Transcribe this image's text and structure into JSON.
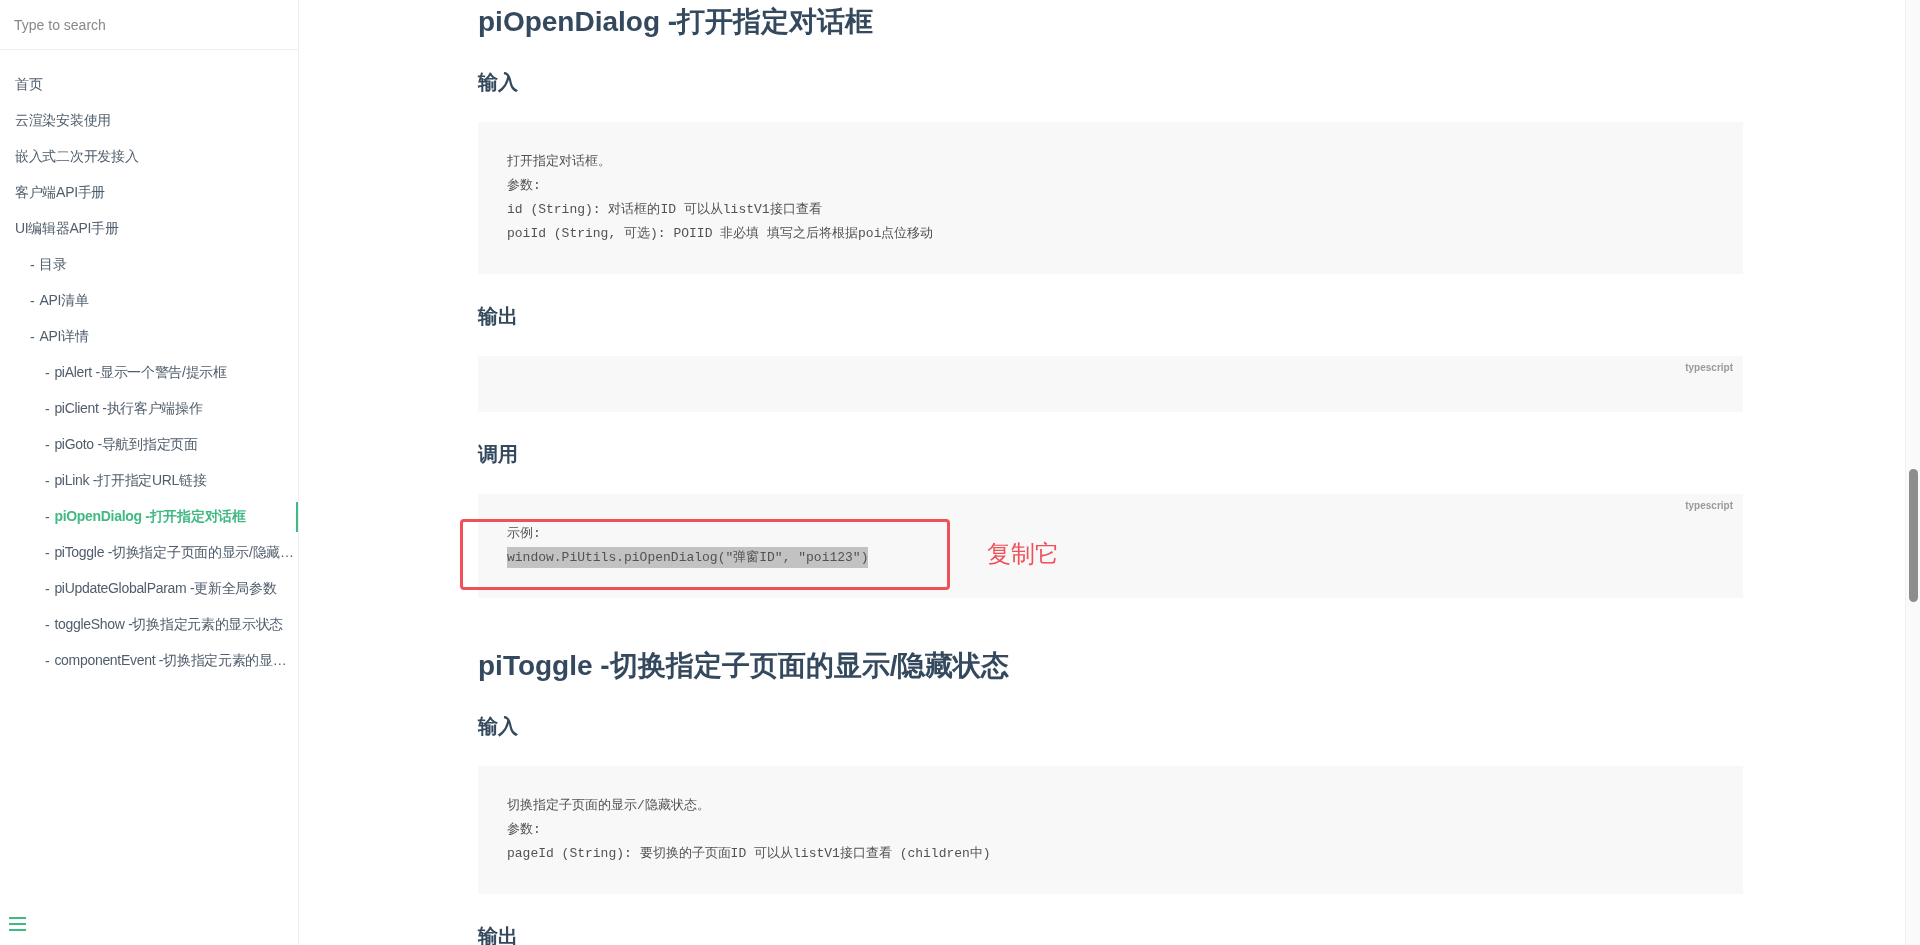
{
  "sidebar": {
    "search": {
      "placeholder": "Type to search"
    },
    "items": [
      {
        "label": "首页",
        "selected": false
      },
      {
        "label": "云渲染安装使用",
        "selected": false
      },
      {
        "label": "嵌入式二次开发接入",
        "selected": false
      },
      {
        "label": "客户端API手册",
        "selected": false
      },
      {
        "label": "UI编辑器API手册",
        "selected": false,
        "children": [
          {
            "marker": "-",
            "label": "目录",
            "selected": false
          },
          {
            "marker": "-",
            "label": "API清单",
            "selected": false
          },
          {
            "marker": "-",
            "label": "API详情",
            "selected": false,
            "children": [
              {
                "marker": "-",
                "label": "piAlert -显示一个警告/提示框",
                "selected": false
              },
              {
                "marker": "-",
                "label": "piClient -执行客户端操作",
                "selected": false
              },
              {
                "marker": "-",
                "label": "piGoto -导航到指定页面",
                "selected": false
              },
              {
                "marker": "-",
                "label": "piLink -打开指定URL链接",
                "selected": false
              },
              {
                "marker": "-",
                "label": "piOpenDialog -打开指定对话框",
                "selected": true
              },
              {
                "marker": "-",
                "label": "piToggle -切换指定子页面的显示/隐藏…",
                "selected": false
              },
              {
                "marker": "-",
                "label": "piUpdateGlobalParam -更新全局参数",
                "selected": false
              },
              {
                "marker": "-",
                "label": "toggleShow -切换指定元素的显示状态",
                "selected": false
              },
              {
                "marker": "-",
                "label": "componentEvent -切换指定元素的显…",
                "selected": false
              }
            ]
          }
        ]
      }
    ]
  },
  "content": {
    "blocks": [
      {
        "kind": "heading",
        "text": "piOpenDialog -打开指定对话框"
      },
      {
        "kind": "subheading",
        "text": "输入"
      },
      {
        "kind": "code",
        "lines": [
          {
            "text": "打开指定对话框。",
            "highlighted": false
          },
          {
            "text": "参数:",
            "highlighted": false
          },
          {
            "text": "id (String): 对话框的ID 可以从listV1接口查看",
            "highlighted": false
          },
          {
            "text": "poiId (String, 可选): POIID 非必填 填写之后将根据poi点位移动",
            "highlighted": false
          }
        ]
      },
      {
        "kind": "subheading",
        "text": "输出"
      },
      {
        "kind": "code",
        "language": "typescript"
      },
      {
        "kind": "subheading",
        "text": "调用"
      },
      {
        "kind": "code",
        "language": "typescript",
        "lines": [
          {
            "text": "示例:",
            "highlighted": false
          },
          {
            "text": "window.PiUtils.piOpenDialog(\"弹窗ID\", \"poi123\")",
            "highlighted": true
          }
        ],
        "annotation": {
          "label": "复制它"
        }
      },
      {
        "kind": "heading",
        "text": "piToggle -切换指定子页面的显示/隐藏状态"
      },
      {
        "kind": "subheading",
        "text": "输入"
      },
      {
        "kind": "code",
        "lines": [
          {
            "text": "切换指定子页面的显示/隐藏状态。",
            "highlighted": false
          },
          {
            "text": "参数:",
            "highlighted": false
          },
          {
            "text": "pageId (String): 要切换的子页面ID 可以从listV1接口查看 (children中)",
            "highlighted": false
          }
        ]
      },
      {
        "kind": "subheading",
        "text": "输出"
      }
    ]
  }
}
